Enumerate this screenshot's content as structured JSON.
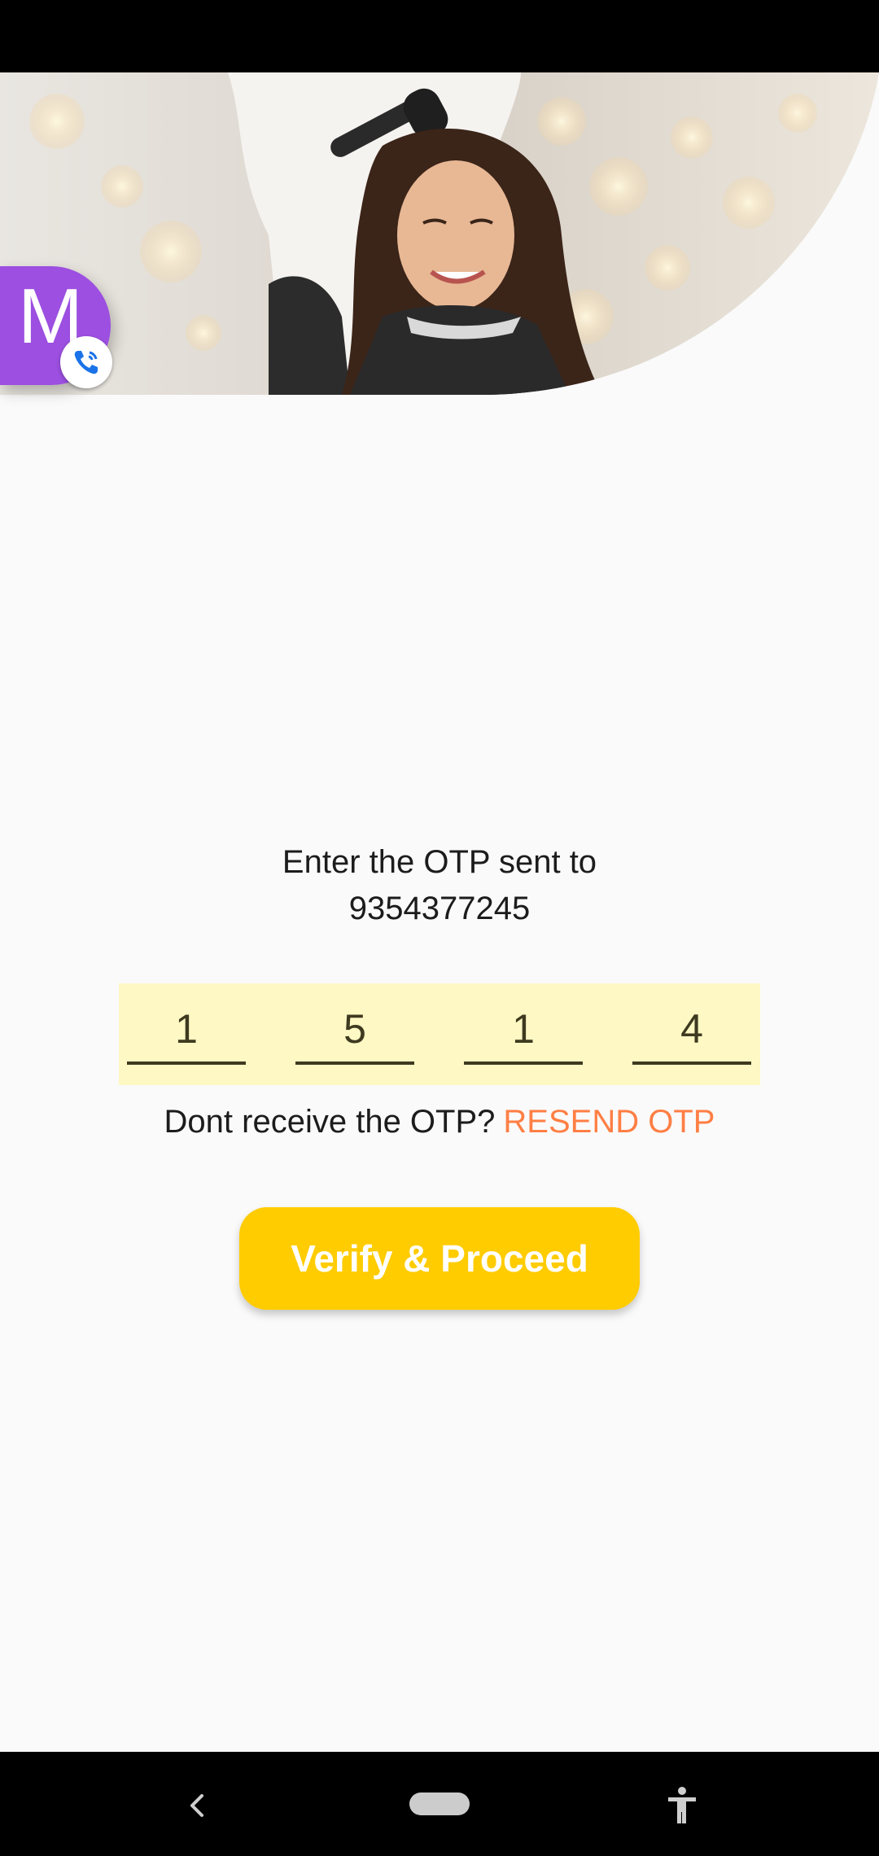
{
  "hero": {
    "image": "salon-hair-styling-photo"
  },
  "floating_contact": {
    "initial": "M",
    "badge_icon": "phone-call-icon",
    "color": "#9c4fe0"
  },
  "otp": {
    "prompt_line1": "Enter the OTP sent to",
    "phone": "9354377245",
    "digits": [
      "1",
      "5",
      "1",
      "4"
    ]
  },
  "resend": {
    "prompt": "Dont receive the OTP?",
    "link": "RESEND OTP"
  },
  "verify_button": {
    "label": "Verify & Proceed"
  },
  "colors": {
    "accent": "#ffcc00",
    "link": "#ff7f45",
    "otp_background": "#fdf8c4"
  },
  "nav": {
    "back_icon": "back-icon",
    "home_icon": "home-pill-icon",
    "accessibility_icon": "accessibility-icon"
  }
}
